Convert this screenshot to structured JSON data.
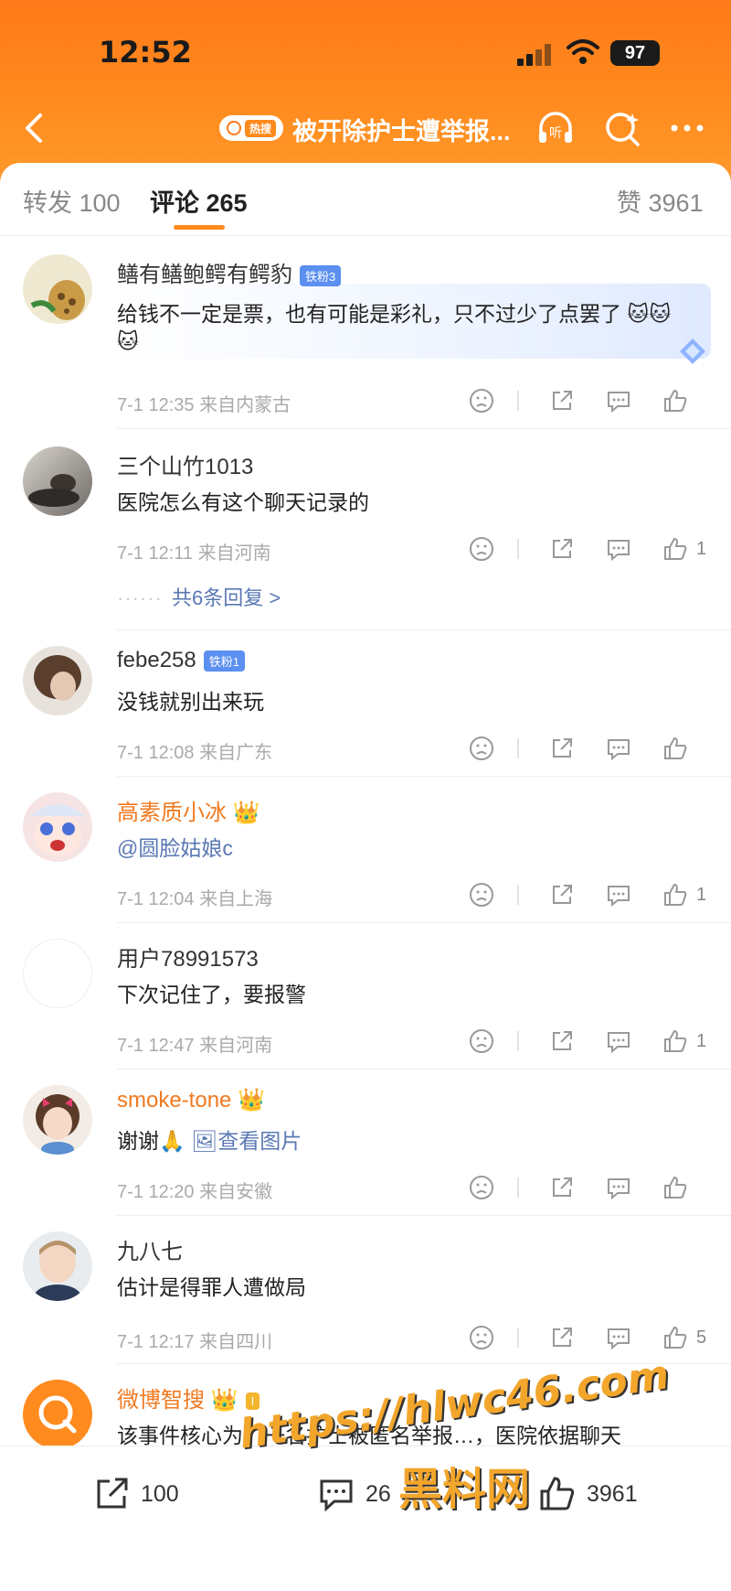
{
  "status": {
    "time": "12:52",
    "battery": "97"
  },
  "nav": {
    "hot_label": "热搜",
    "title": "被开除护士遭举报...",
    "listen_label": "听"
  },
  "tabs": [
    {
      "label": "转发 100"
    },
    {
      "label": "评论 265"
    },
    {
      "label": "赞 3961"
    }
  ],
  "comments": [
    {
      "user": "鳝有鳝鲍鳄有鳄豹",
      "badge": "铁粉3",
      "text": "给钱不一定是票，也有可能是彩礼，只不过少了点罢了",
      "text2": "",
      "meta": "7-1 12:35 来自内蒙古",
      "likes": ""
    },
    {
      "user": "三个山竹1013",
      "badge": "",
      "text": "医院怎么有这个聊天记录的",
      "meta": "7-1 12:11 来自河南",
      "likes": "1",
      "replies": "共6条回复 >"
    },
    {
      "user": "febe258",
      "badge": "铁粉1",
      "text": "没钱就别出来玩",
      "meta": "7-1 12:08 来自广东",
      "likes": ""
    },
    {
      "user": "高素质小冰",
      "badge": "",
      "text": "@圆脸姑娘c",
      "meta": "7-1 12:04 来自上海",
      "likes": "1"
    },
    {
      "user": "用户78991573",
      "badge": "",
      "text": "下次记住了，要报警",
      "meta": "7-1 12:47 来自河南",
      "likes": "1"
    },
    {
      "user": "smoke-tone",
      "badge": "",
      "text": "谢谢",
      "link": "查看图片",
      "meta": "7-1 12:20 来自安徽",
      "likes": ""
    },
    {
      "user": "九八七",
      "badge": "",
      "text": "估计是得罪人遭做局",
      "meta": "7-1 12:17 来自四川",
      "likes": "5"
    },
    {
      "user": "微博智搜",
      "badge": "I",
      "text": "该事件核心为：一名护士被匿名举报…，医院依据聊天",
      "meta": "",
      "likes": ""
    }
  ],
  "bottom_bar": {
    "repost": "100",
    "comment": "26",
    "like": "3961"
  },
  "watermark": {
    "url": "https://hlwc46.com",
    "name": "黑料网"
  },
  "colors": {
    "header": "#ff8a1e",
    "accent": "#ff8a1e",
    "link": "#5a78b4",
    "gold_name": "#f07a20"
  }
}
